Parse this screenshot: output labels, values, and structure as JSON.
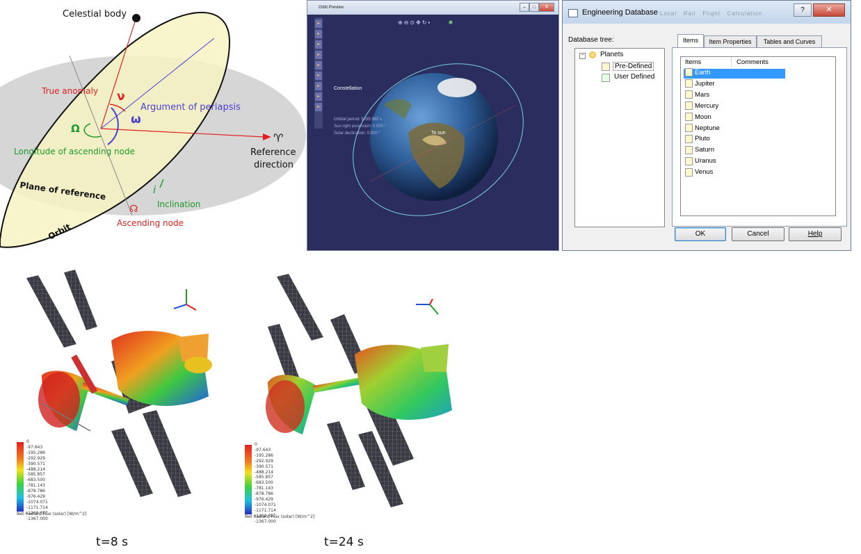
{
  "diagram": {
    "celestial_body": "Celestial body",
    "true_anomaly": "True anomaly",
    "nu_symbol": "ν",
    "arg_periapsis": "Argument of periapsis",
    "omega_symbol": "ω",
    "big_omega_symbol": "Ω",
    "long_asc_node": "Longitude of ascending node",
    "aries_symbol": "♈",
    "reference": "Reference",
    "direction": "direction",
    "plane_of_reference": "Plane of reference",
    "i_symbol": "i",
    "inclination": "Inclination",
    "node_symbol": "☊",
    "ascending_node": "Ascending node",
    "orbit": "Orbit"
  },
  "preview": {
    "window_title": "Orbit Preview",
    "label_constellation": "Constellation",
    "label_to_sun": "To sun",
    "info_line1": "Orbital period: 5035.982 s",
    "info_line2": "Sun right ascension: 0.000 °",
    "info_line3": "Solar declination: 0.000 °"
  },
  "database": {
    "window_title": "Engineering Database",
    "tree_label": "Database tree:",
    "tree": {
      "root": "Planets",
      "children": [
        "Pre-Defined",
        "User Defined"
      ]
    },
    "tabs": [
      "Items",
      "Item Properties",
      "Tables and Curves"
    ],
    "columns": [
      "Items",
      "Comments"
    ],
    "items": [
      "Earth",
      "Jupiter",
      "Mars",
      "Mercury",
      "Moon",
      "Neptune",
      "Pluto",
      "Saturn",
      "Uranus",
      "Venus"
    ],
    "buttons": {
      "ok": "OK",
      "cancel": "Cancel",
      "help": "Help"
    },
    "background_menu": [
      "Local",
      "Rail",
      "Flight",
      "Calculation"
    ]
  },
  "satellites": {
    "captions": [
      "t=8 s",
      "t=24 s"
    ],
    "legend_title": "Net Radiant Flux (solar) [W/m^2]",
    "legend_values": [
      "0",
      "-97.643",
      "-195.286",
      "-292.929",
      "-390.571",
      "-488.214",
      "-585.857",
      "-683.500",
      "-781.143",
      "-878.786",
      "-976.429",
      "-1074.071",
      "-1171.714",
      "-1269.357",
      "-1367.000"
    ]
  },
  "colors": {
    "orbit_fill": "#f7f3c4",
    "plane_fill": "#d6d6d6",
    "red_label": "#e02020",
    "blue_label": "#4a3fd0",
    "green_label": "#1a9a2a",
    "space_bg": "#2b2d5e"
  }
}
